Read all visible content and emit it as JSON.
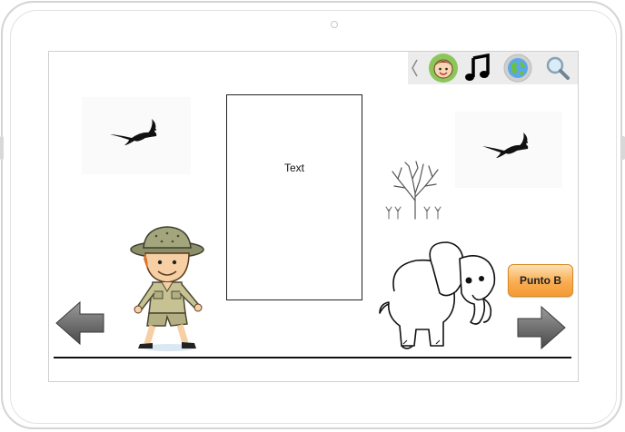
{
  "device": {
    "type": "tablet"
  },
  "toolbar": {
    "icons": [
      "chevron-left-icon",
      "child-face-icon",
      "music-note-icon",
      "globe-icon",
      "magnifier-icon"
    ]
  },
  "text_box": {
    "label": "Text"
  },
  "punto_button": {
    "label": "Punto B"
  },
  "colors": {
    "button_orange": "#f9ad52",
    "button_border": "#d98a22",
    "avatar_green": "#8cc65b",
    "arrow_gray": "#6a6a6a"
  }
}
